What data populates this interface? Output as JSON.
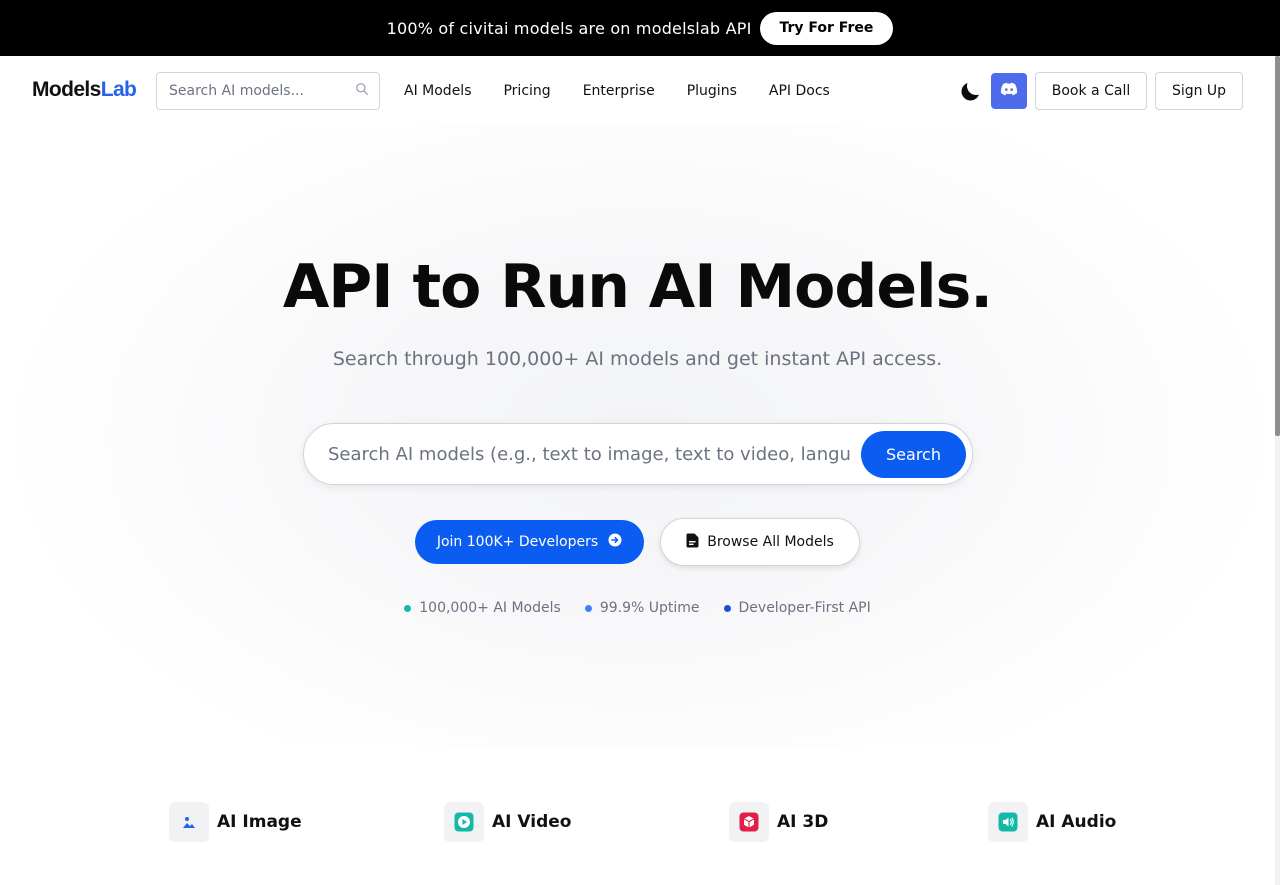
{
  "promo": {
    "text": "100% of civitai models are on modelslab API",
    "button": "Try For Free"
  },
  "header": {
    "logo_part1": "Models",
    "logo_part2": "Lab",
    "search_placeholder": "Search AI models...",
    "nav": [
      "AI Models",
      "Pricing",
      "Enterprise",
      "Plugins",
      "API Docs"
    ],
    "book_call": "Book a Call",
    "sign_up": "Sign Up"
  },
  "hero": {
    "title": "API to Run AI Models.",
    "subtitle": "Search through 100,000+ AI models and get instant API access.",
    "search_placeholder": "Search AI models (e.g., text to image, text to video, language models)...",
    "search_button": "Search",
    "join_button": "Join 100K+ Developers",
    "browse_button": "Browse All Models",
    "stats": [
      {
        "label": "100,000+ AI Models",
        "color": "#14b8a6"
      },
      {
        "label": "99.9% Uptime",
        "color": "#3b82f6"
      },
      {
        "label": "Developer-First API",
        "color": "#1d4ed8"
      }
    ]
  },
  "categories": [
    {
      "label": "AI Image",
      "icon": "image-icon",
      "color": "#2563eb"
    },
    {
      "label": "AI Video",
      "icon": "video-icon",
      "color": "#14b8a6"
    },
    {
      "label": "AI 3D",
      "icon": "cube-icon",
      "color": "#e11d48"
    },
    {
      "label": "AI Audio",
      "icon": "audio-icon",
      "color": "#14b8a6"
    }
  ],
  "colors": {
    "accent": "#0b5cf0",
    "discord": "#4f6bed",
    "promo_bg": "#000000"
  }
}
